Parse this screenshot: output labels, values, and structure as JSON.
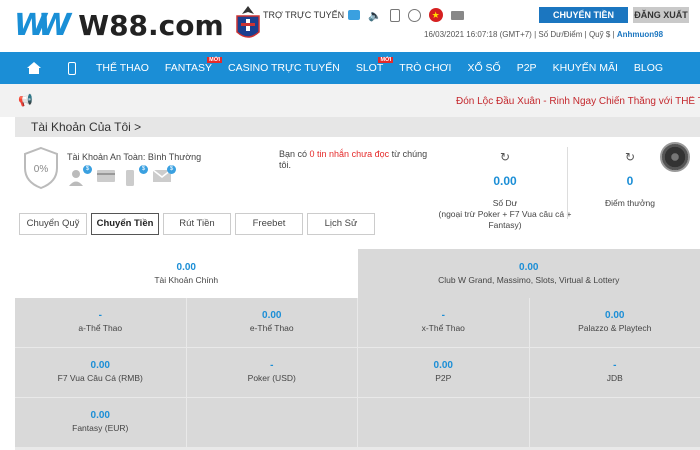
{
  "brand": {
    "logo_mark": "W",
    "logo_text": "W88.com"
  },
  "header": {
    "support_label": "TRỢ TRỰC TUYẾN",
    "transfer_button": "CHUYỂN TIỀN",
    "logout_button": "ĐĂNG XUẤT",
    "datetime": "16/03/2021 16:07:18 (GMT+7)",
    "balance_label": "Số Dư/Điểm",
    "fund_label": "Quỹ $",
    "username": "Anhmuon98",
    "flag_star": "★"
  },
  "nav": {
    "items": [
      {
        "label": "THỂ THAO",
        "badge": ""
      },
      {
        "label": "FANTASY",
        "badge": "MỚI"
      },
      {
        "label": "CASINO TRỰC TUYẾN",
        "badge": ""
      },
      {
        "label": "SLOT",
        "badge": "MỚI"
      },
      {
        "label": "TRÒ CHƠI",
        "badge": ""
      },
      {
        "label": "XỔ SỐ",
        "badge": ""
      },
      {
        "label": "P2P",
        "badge": ""
      },
      {
        "label": "KHUYẾN MÃI",
        "badge": ""
      },
      {
        "label": "BLOG",
        "badge": ""
      }
    ]
  },
  "ticker": {
    "text": "Đón Lộc Đầu Xuân - Rinh Ngay Chiến Thắng với THỂ T"
  },
  "account": {
    "title": "Tài Khoản Của Tôi >",
    "security_percent": "0%",
    "security_label": "Tài Khoản An Toàn: Bình Thường",
    "badge_symbol": "$",
    "message_prefix": "Bạn có ",
    "message_highlight": "0 tin nhắn chưa đọc",
    "message_suffix": " từ chúng tôi.",
    "balance_value": "0.00",
    "balance_label": "Số Dư",
    "balance_note": "(ngoại trừ Poker + F7 Vua câu cá + Fantasy)",
    "points_value": "0",
    "points_label": "Điểm thưởng",
    "refresh_symbol": "↻"
  },
  "tabs": [
    {
      "label": "Chuyển Quỹ",
      "active": false
    },
    {
      "label": "Chuyển Tiền",
      "active": true
    },
    {
      "label": "Rút Tiền",
      "active": false
    },
    {
      "label": "Freebet",
      "active": false
    },
    {
      "label": "Lịch Sử",
      "active": false
    }
  ],
  "wallets_top": [
    {
      "value": "0.00",
      "label": "Tài Khoản Chính"
    },
    {
      "value": "0.00",
      "label": "Club W Grand, Massimo, Slots, Virtual & Lottery"
    }
  ],
  "wallets": [
    {
      "value": "-",
      "label": "a-Thể Thao"
    },
    {
      "value": "0.00",
      "label": "e-Thể Thao"
    },
    {
      "value": "-",
      "label": "x-Thể Thao"
    },
    {
      "value": "0.00",
      "label": "Palazzo & Playtech"
    },
    {
      "value": "0.00",
      "label": "F7 Vua Câu Cá (RMB)"
    },
    {
      "value": "-",
      "label": "Poker (USD)"
    },
    {
      "value": "0.00",
      "label": "P2P"
    },
    {
      "value": "-",
      "label": "JDB"
    },
    {
      "value": "0.00",
      "label": "Fantasy (EUR)"
    }
  ]
}
